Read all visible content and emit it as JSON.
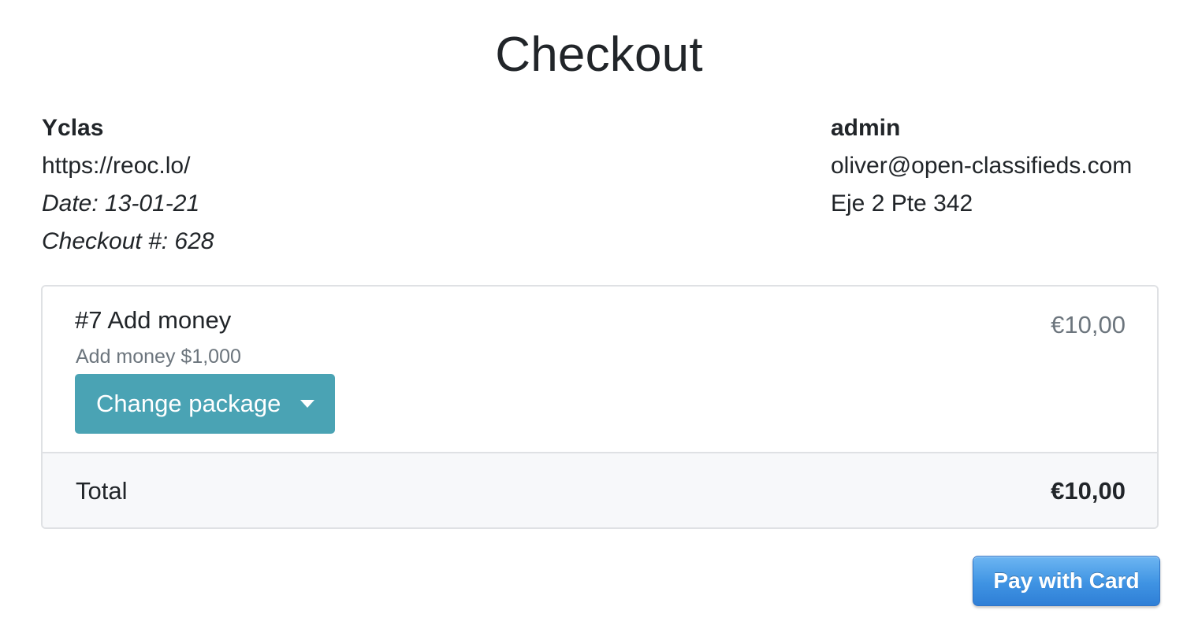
{
  "page": {
    "title": "Checkout"
  },
  "seller": {
    "name": "Yclas",
    "url": "https://reoc.lo/",
    "date": "Date: 13-01-21",
    "checkout_number": "Checkout #: 628"
  },
  "buyer": {
    "name": "admin",
    "email": "oliver@open-classifieds.com",
    "address": "Eje 2 Pte 342"
  },
  "order": {
    "item": {
      "title": "#7 Add money",
      "description": "Add money $1,000",
      "price": "€10,00",
      "change_package_label": "Change package"
    },
    "total_label": "Total",
    "total_value": "€10,00"
  },
  "actions": {
    "pay_label": "Pay with Card"
  },
  "colors": {
    "change_button": "#4aa3b4",
    "pay_button": "#3f93e3",
    "muted_text": "#6c757d",
    "total_row_bg": "#f7f8fa"
  },
  "icons": {
    "dropdown": "caret-down-icon"
  }
}
